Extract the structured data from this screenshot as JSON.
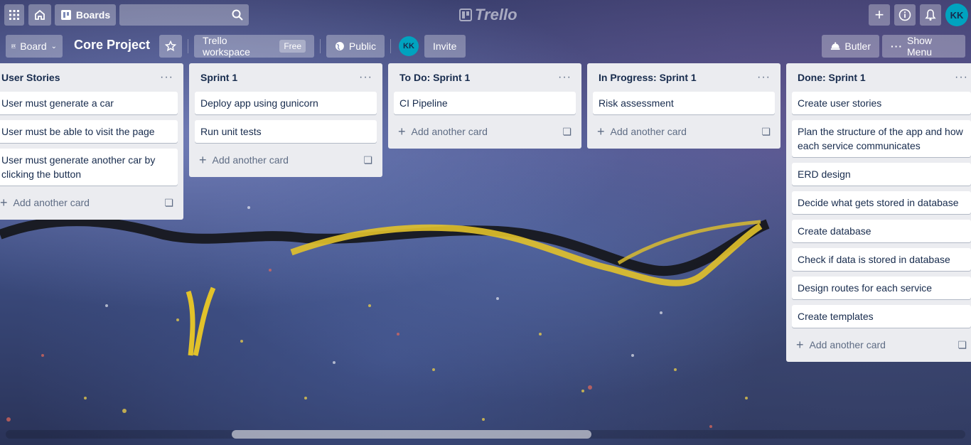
{
  "topbar": {
    "boards_label": "Boards",
    "logo_text": "Trello",
    "avatar_initials": "KK"
  },
  "board_header": {
    "view_label": "Board",
    "title": "Core Project",
    "workspace_label": "Trello workspace",
    "workspace_badge": "Free",
    "visibility_label": "Public",
    "member_initials": "KK",
    "invite_label": "Invite",
    "butler_label": "Butler",
    "show_menu_label": "Show Menu"
  },
  "lists": [
    {
      "title": "User Stories",
      "cards": [
        "User must generate a car",
        "User must be able to visit the page",
        "User must generate another car by clicking the button"
      ],
      "add_label": "Add another card"
    },
    {
      "title": "Sprint 1",
      "cards": [
        "Deploy app using gunicorn",
        "Run unit tests"
      ],
      "add_label": "Add another card"
    },
    {
      "title": "To Do: Sprint 1",
      "cards": [
        "CI Pipeline"
      ],
      "add_label": "Add another card"
    },
    {
      "title": "In Progress: Sprint 1",
      "cards": [
        "Risk assessment"
      ],
      "add_label": "Add another card"
    },
    {
      "title": "Done: Sprint 1",
      "cards": [
        "Create user stories",
        "Plan the structure of the app and how each service communicates",
        "ERD design",
        "Decide what gets stored in database",
        "Create database",
        "Check if data is stored in database",
        "Design routes for each service",
        "Create templates"
      ],
      "add_label": "Add another card"
    }
  ],
  "colors": {
    "list_bg": "#ebecf0",
    "avatar": "#00a3bf",
    "text": "#172b4d"
  }
}
